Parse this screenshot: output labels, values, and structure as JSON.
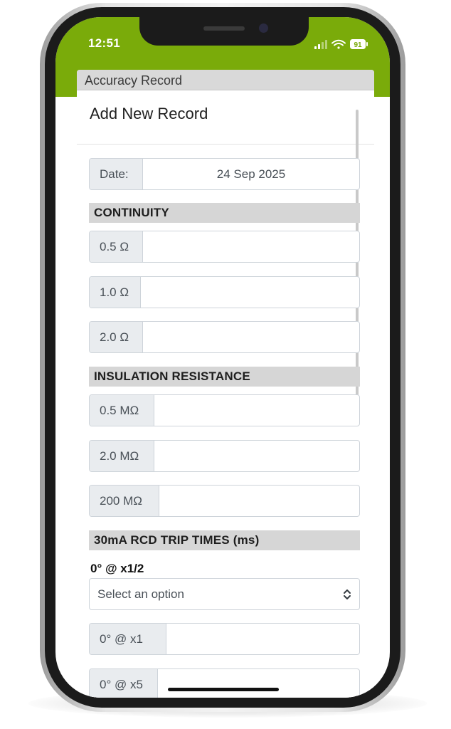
{
  "status_bar": {
    "time": "12:51",
    "battery": "91",
    "color": "#7aab0a"
  },
  "window": {
    "title": "Accuracy Record"
  },
  "form": {
    "heading": "Add New Record",
    "date": {
      "label": "Date:",
      "value": "24 Sep 2025"
    },
    "sections": {
      "continuity": {
        "title": "CONTINUITY",
        "fields": [
          {
            "label": "0.5 Ω",
            "value": ""
          },
          {
            "label": "1.0 Ω",
            "value": ""
          },
          {
            "label": "2.0 Ω",
            "value": ""
          }
        ]
      },
      "insulation": {
        "title": "INSULATION RESISTANCE",
        "fields": [
          {
            "label": "0.5 MΩ",
            "value": ""
          },
          {
            "label": "2.0 MΩ",
            "value": ""
          },
          {
            "label": "200 MΩ",
            "value": ""
          }
        ]
      },
      "rcd": {
        "title": "30mA RCD TRIP TIMES (ms)",
        "select_label": "0° @ x1/2",
        "select_value": "Select an option",
        "fields": [
          {
            "label": "0° @ x1",
            "value": ""
          },
          {
            "label": "0° @ x5",
            "value": ""
          }
        ]
      }
    }
  },
  "icons": {
    "signal": "signal-icon",
    "wifi": "wifi-icon",
    "battery": "battery-icon",
    "select_arrow": "chevron-up-down-icon"
  }
}
